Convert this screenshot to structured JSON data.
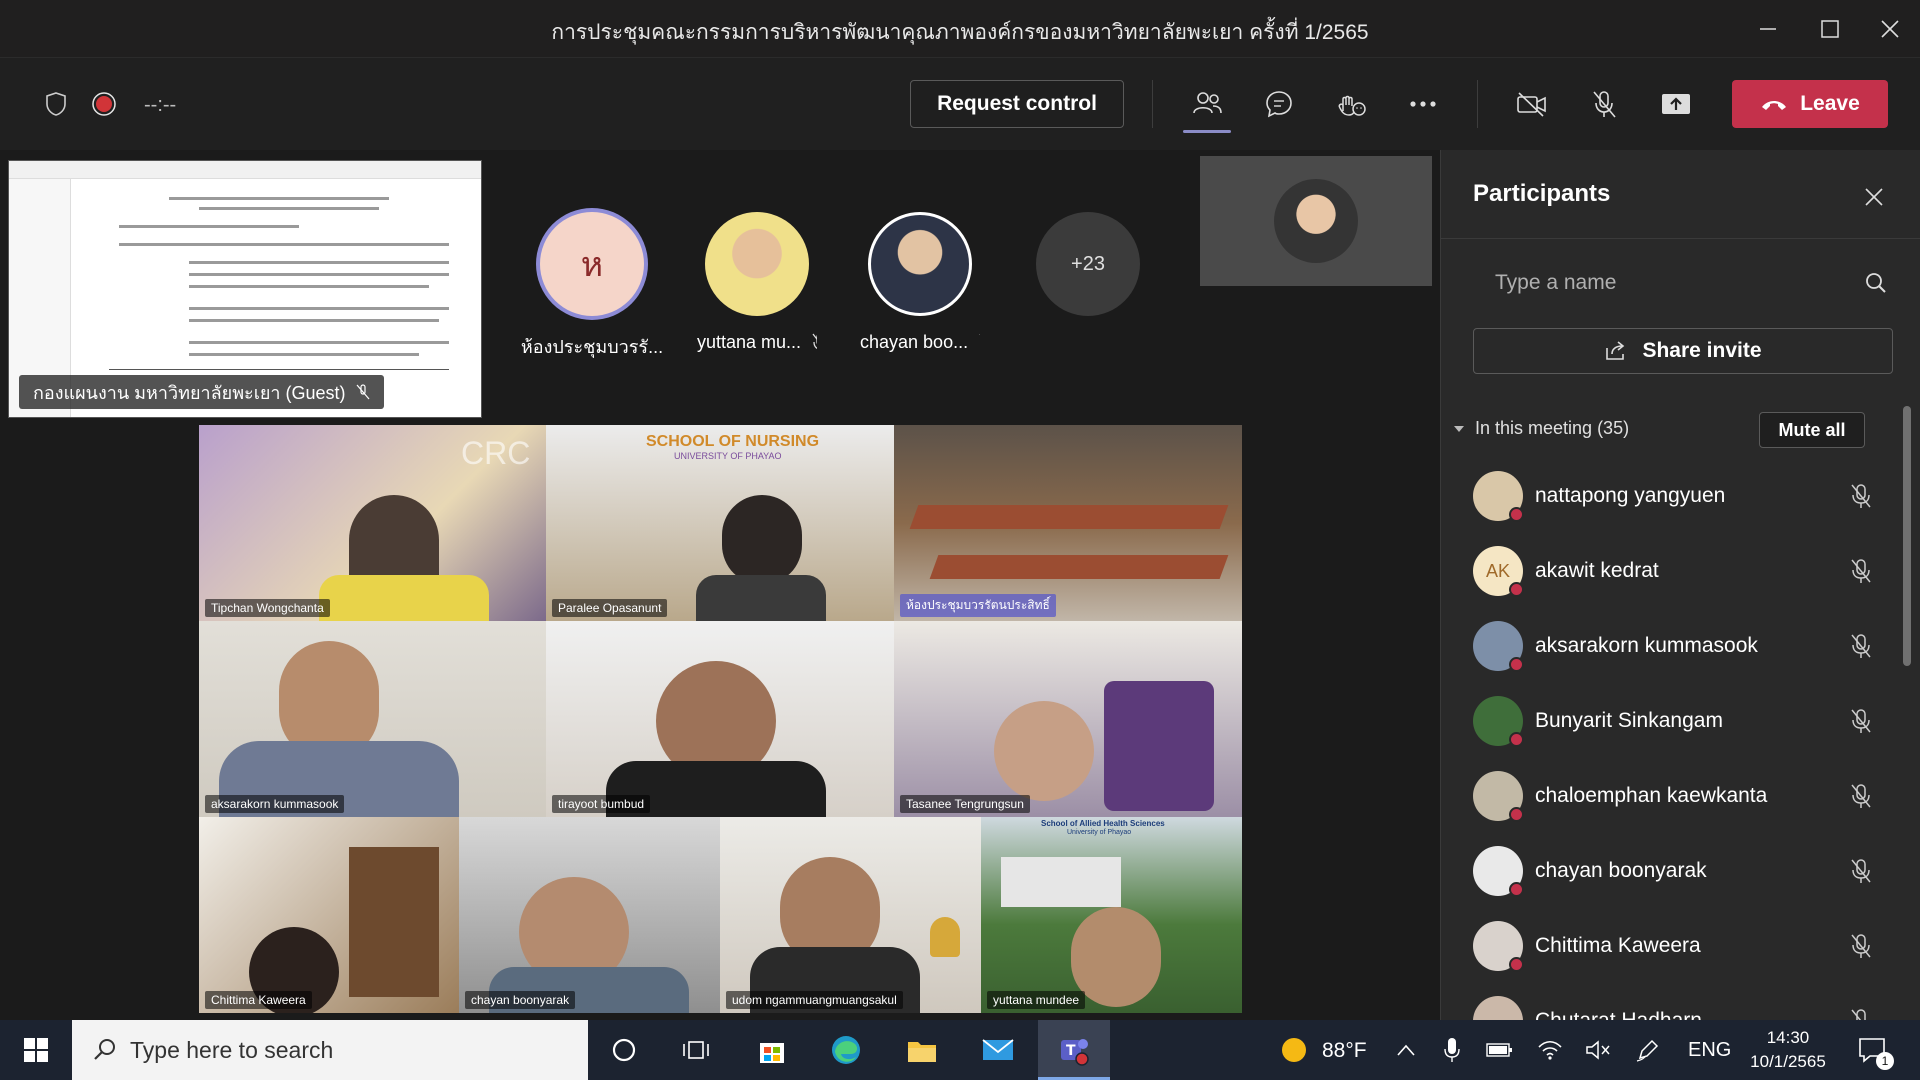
{
  "window": {
    "title": "การประชุมคณะกรรมการบริหารพัฒนาคุณภาพองค์กรของมหาวิทยาลัยพะเยา ครั้งที่ 1/2565"
  },
  "toolbar": {
    "timer": "--:--",
    "request_control_label": "Request control",
    "leave_label": "Leave"
  },
  "stage": {
    "shared_label": "กองแผนงาน มหาวิทยาลัยพะเยา (Guest)",
    "avatars": [
      {
        "name": "ห้องประชุมบวรรั...",
        "initial": "ห",
        "muted": false
      },
      {
        "name": "yuttana mu...",
        "muted": true
      },
      {
        "name": "chayan boo...",
        "muted": true
      }
    ],
    "overflow_count": "+23",
    "grid": [
      {
        "name": "Tipchan Wongchanta"
      },
      {
        "name": "Paralee Opasanunt"
      },
      {
        "name": "ห้องประชุมบวรรัตนประสิทธิ์"
      },
      {
        "name": "aksarakorn kummasook"
      },
      {
        "name": "tirayoot bumbud"
      },
      {
        "name": "Tasanee Tengrungsun"
      },
      {
        "name": "Chittima Kaweera"
      },
      {
        "name": "chayan boonyarak"
      },
      {
        "name": "udom ngammuangmuangsakul"
      },
      {
        "name": "yuttana mundee"
      }
    ],
    "grid_banner_nursing": "SCHOOL OF NURSING",
    "grid_banner_nursing_sub": "UNIVERSITY OF PHAYAO",
    "grid_banner_crc": "CRC",
    "grid_banner_allied": "School of Allied Health Sciences",
    "grid_banner_allied_sub": "University of Phayao"
  },
  "panel": {
    "title": "Participants",
    "search_placeholder": "Type a name",
    "share_invite_label": "Share invite",
    "in_meeting_label": "In this meeting (35)",
    "mute_all_label": "Mute all",
    "participants": [
      {
        "name": "nattapong yangyuen",
        "initials": "",
        "color": "#d9c7a8"
      },
      {
        "name": "akawit kedrat",
        "initials": "AK",
        "color": "#f5e6c4"
      },
      {
        "name": "aksarakorn kummasook",
        "initials": "",
        "color": "#7d8fa8"
      },
      {
        "name": "Bunyarit Sinkangam",
        "initials": "",
        "color": "#3f6e3a"
      },
      {
        "name": "chaloemphan kaewkanta",
        "initials": "",
        "color": "#c2b9a6"
      },
      {
        "name": "chayan boonyarak",
        "initials": "",
        "color": "#e9e9e9"
      },
      {
        "name": "Chittima Kaweera",
        "initials": "",
        "color": "#d9d2cc"
      },
      {
        "name": "Chutarat Hadharn",
        "initials": "",
        "color": "#cbb8a9"
      }
    ]
  },
  "taskbar": {
    "search_placeholder": "Type here to search",
    "weather": "88°F",
    "language": "ENG",
    "time": "14:30",
    "date": "10/1/2565",
    "notification_count": "1"
  }
}
